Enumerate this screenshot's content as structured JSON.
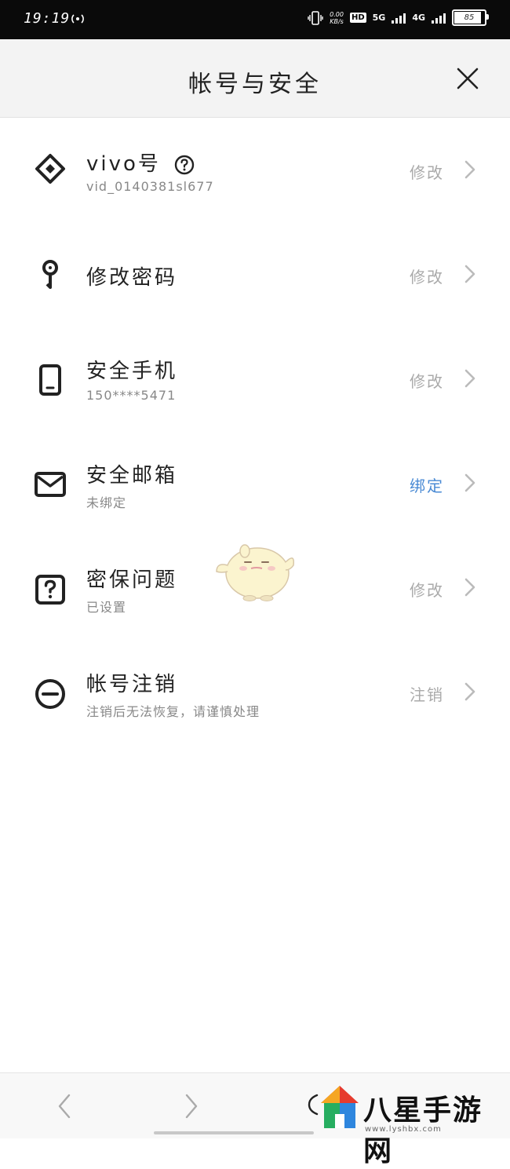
{
  "status_bar": {
    "time": "19:19",
    "net_speed_value": "0.00",
    "net_speed_unit": "KB/s",
    "hd_label": "HD",
    "signal_1": "5G",
    "signal_2": "4G",
    "battery": "85",
    "battery_level": 0.85
  },
  "header": {
    "title": "帐号与安全"
  },
  "rows": [
    {
      "title": "vivo号",
      "subtitle": "vid_0140381sl677",
      "action": "修改",
      "icon": "vivo-account-icon"
    },
    {
      "title": "修改密码",
      "subtitle": "",
      "action": "修改",
      "icon": "key-icon"
    },
    {
      "title": "安全手机",
      "subtitle": "150****5471",
      "action": "修改",
      "icon": "phone-icon"
    },
    {
      "title": "安全邮箱",
      "subtitle": "未绑定",
      "action": "绑定",
      "icon": "mail-icon"
    },
    {
      "title": "密保问题",
      "subtitle": "已设置",
      "action": "修改",
      "icon": "question-icon"
    },
    {
      "title": "帐号注销",
      "subtitle": "注销后无法恢复，请谨慎处理",
      "action": "注销",
      "icon": "minus-circle-icon"
    }
  ],
  "colors": {
    "accent_blue": "#4a8ad4",
    "action_gray": "#aaaaaa"
  },
  "watermark": {
    "text": "八星手游网",
    "url": "www.lyshbx.com"
  }
}
